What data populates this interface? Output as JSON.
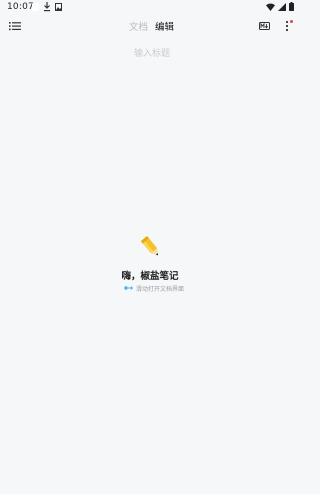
{
  "status_bar": {
    "time": "10:07",
    "icons": [
      "notification-icon",
      "download-icon",
      "image-icon",
      "wifi-icon",
      "signal-icon",
      "battery-icon"
    ]
  },
  "toolbar": {
    "tabs": [
      {
        "label": "文档",
        "active": false
      },
      {
        "label": "编辑",
        "active": true
      }
    ],
    "menu_icon": "list-menu-icon",
    "preview_icon": "markdown-preview-icon",
    "more_icon": "more-vert-icon",
    "badge_color": "#e24848"
  },
  "editor": {
    "title_placeholder": "输入标题",
    "title_value": ""
  },
  "empty_state": {
    "icon": "pencil-icon",
    "heading": "嗨，椒盐笔记",
    "hint_icon": "swipe-icon",
    "hint": "滑动打开文档界面",
    "hint_color": "#39b6e6"
  }
}
